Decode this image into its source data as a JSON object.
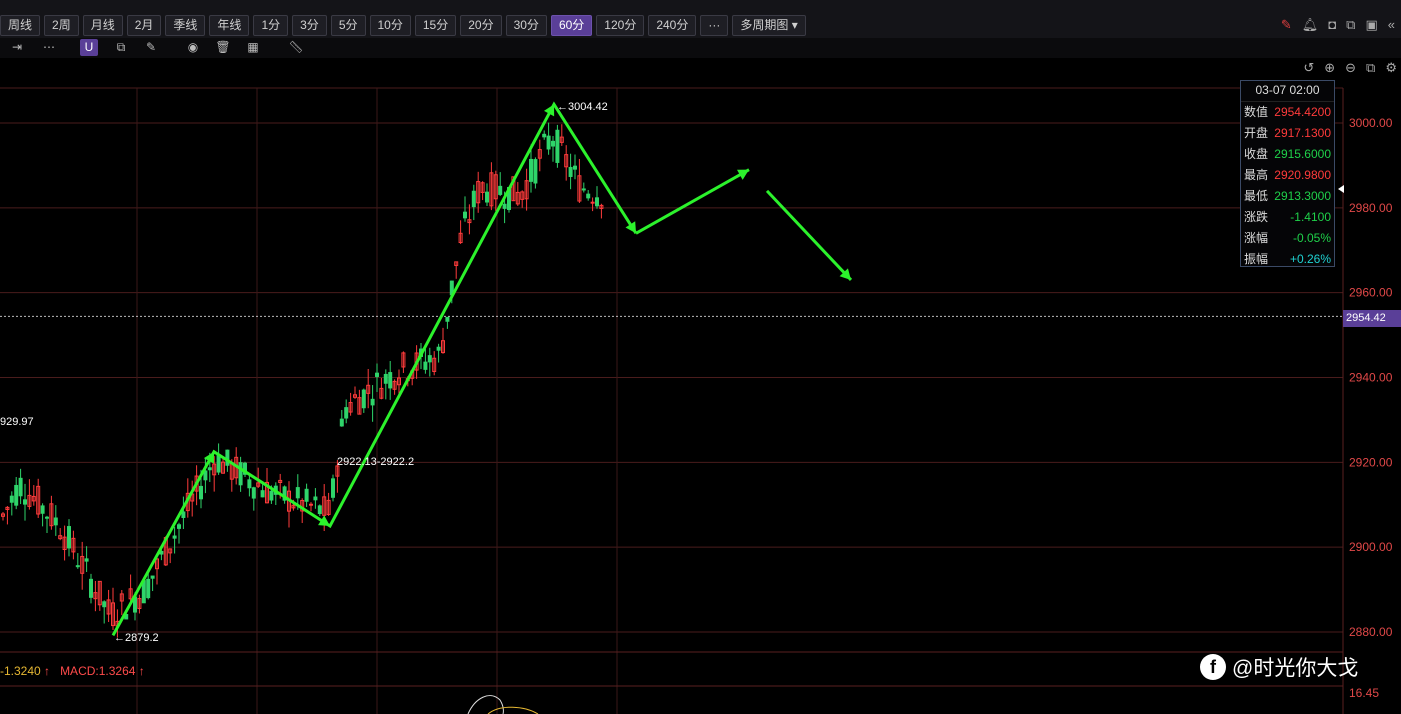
{
  "toolbar": {
    "periods": [
      "周线",
      "2周",
      "月线",
      "2月",
      "季线",
      "年线",
      "1分",
      "3分",
      "5分",
      "10分",
      "15分",
      "20分",
      "30分",
      "60分",
      "120分",
      "240分",
      "···",
      "多周期图"
    ],
    "active_period": "60分"
  },
  "info_panel": {
    "time": "03-07 02:00",
    "rows": [
      {
        "label": "数值",
        "value": "2954.4200",
        "color": "up"
      },
      {
        "label": "开盘",
        "value": "2917.1300",
        "color": "up"
      },
      {
        "label": "收盘",
        "value": "2915.6000",
        "color": "dn"
      },
      {
        "label": "最高",
        "value": "2920.9800",
        "color": "up"
      },
      {
        "label": "最低",
        "value": "2913.3000",
        "color": "dn"
      },
      {
        "label": "涨跌",
        "value": "-1.4100",
        "color": "dn"
      },
      {
        "label": "涨幅",
        "value": "-0.05%",
        "color": "dn"
      },
      {
        "label": "振幅",
        "value": "+0.26%",
        "color": "cy"
      }
    ]
  },
  "price_axis": {
    "labels": [
      "3000.00",
      "2980.00",
      "2960.00",
      "2940.00",
      "2920.00",
      "2900.00",
      "2880.00"
    ],
    "current_price": "2954.42",
    "macd_axis_value": "16.45"
  },
  "annotations": {
    "peak": "←3004.42",
    "low": "←2879.2",
    "mid": "2922.13-2922.2",
    "left_edge": "929.97"
  },
  "macd": {
    "left_value": "-1.3240",
    "macd_label": "MACD:1.3264"
  },
  "watermark": "@时光你大戈",
  "chart_data": {
    "type": "candlestick",
    "yaxis": {
      "min": 2875,
      "max": 3010,
      "ticks": [
        2880,
        2900,
        2920,
        2940,
        2960,
        2980,
        3000
      ]
    },
    "current_price": 2954.42,
    "key_points": {
      "high": 3004.42,
      "low": 2879.2,
      "mid": 2922.2
    },
    "arrow_path": [
      2879.2,
      2922.5,
      2905,
      3004.4,
      2974,
      2989,
      2984,
      2963
    ]
  }
}
